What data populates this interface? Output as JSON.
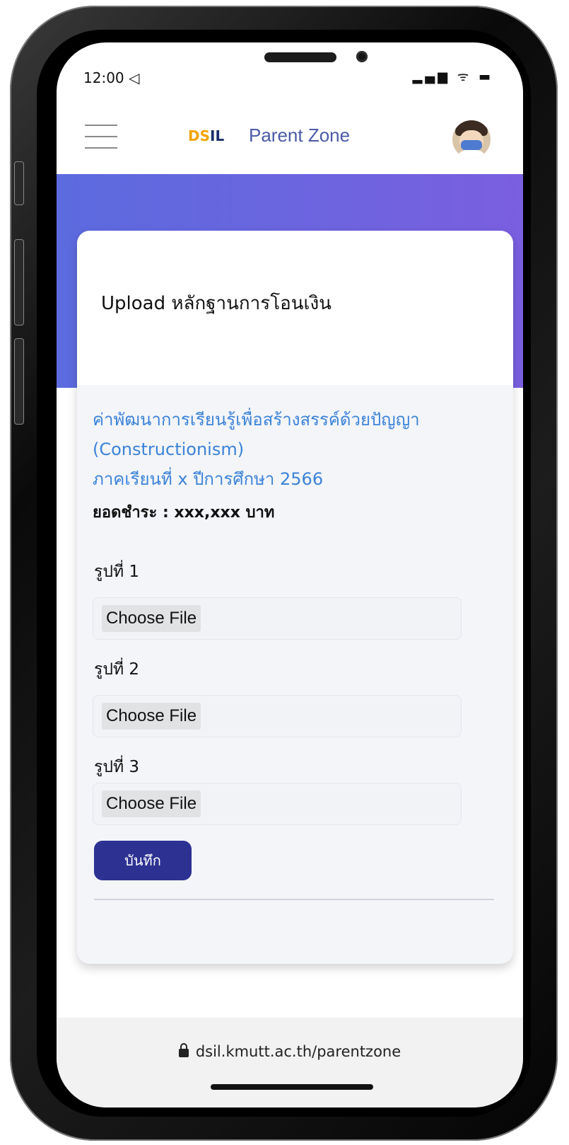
{
  "status_bar": {
    "time": "12:00 ◁",
    "icons": "▂▄▆ ᯤ ▬"
  },
  "header": {
    "logo_part1": "DS",
    "logo_part2": "IL",
    "title": "Parent Zone"
  },
  "card": {
    "title": "Upload หลักฐานการโอนเงิน",
    "course_name": "ค่าพัฒนาการเรียนรู้เพื่อสร้างสรรค์ด้วยปัญญา",
    "course_subtitle": "(Constructionism)",
    "term": "ภาคเรียนที่ x ปีการศึกษา 2566",
    "amount": "ยอดชำระ : xxx,xxx บาท",
    "uploads": [
      {
        "label": "รูปที่ 1",
        "button": "Choose File"
      },
      {
        "label": "รูปที่ 2",
        "button": "Choose File"
      },
      {
        "label": "รูปที่ 3",
        "button": "Choose File"
      }
    ],
    "save_label": "บันทึก"
  },
  "browser": {
    "url": "dsil.kmutt.ac.th/parentzone"
  },
  "colors": {
    "accent": "#2c3192",
    "gradient_start": "#5c6bdf",
    "gradient_end": "#7a5fe0",
    "link_blue": "#3c83d8"
  }
}
